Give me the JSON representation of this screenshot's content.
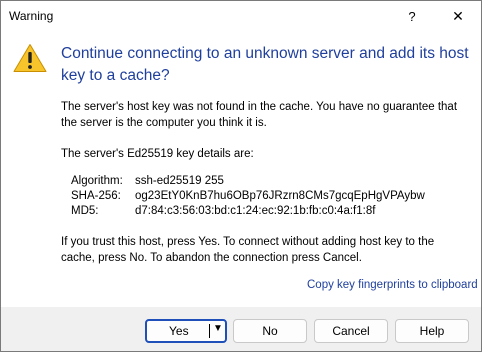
{
  "window": {
    "title": "Warning",
    "help_glyph": "?",
    "close_glyph": "✕"
  },
  "icon": "warning-icon",
  "heading": "Continue connecting to an unknown server and add its host key to a cache?",
  "paragraph1": "The server's host key was not found in the cache. You have no guarantee that the server is the computer you think it is.",
  "paragraph2": "The server's Ed25519 key details are:",
  "key_details": {
    "algorithm_label": "Algorithm:",
    "algorithm_value": "ssh-ed25519 255",
    "sha256_label": "SHA-256:",
    "sha256_value": "og23EtY0KnB7hu6OBp76JRzrn8CMs7gcqEpHgVPAybw",
    "md5_label": "MD5:",
    "md5_value": "d7:84:c3:56:03:bd:c1:24:ec:92:1b:fb:c0:4a:f1:8f"
  },
  "paragraph3": "If you trust this host, press Yes. To connect without adding host key to the cache, press No. To abandon the connection press Cancel.",
  "copy_link": "Copy key fingerprints to clipboard",
  "buttons": {
    "yes": "Yes",
    "yes_caret": "▼",
    "no": "No",
    "cancel": "Cancel",
    "help": "Help"
  },
  "colors": {
    "heading": "#1f3f9c",
    "link": "#1f3f9c",
    "default_button_border": "#1f4fb8",
    "warning_fill": "#f7c52b",
    "footer_bg": "#f0f0f0"
  }
}
